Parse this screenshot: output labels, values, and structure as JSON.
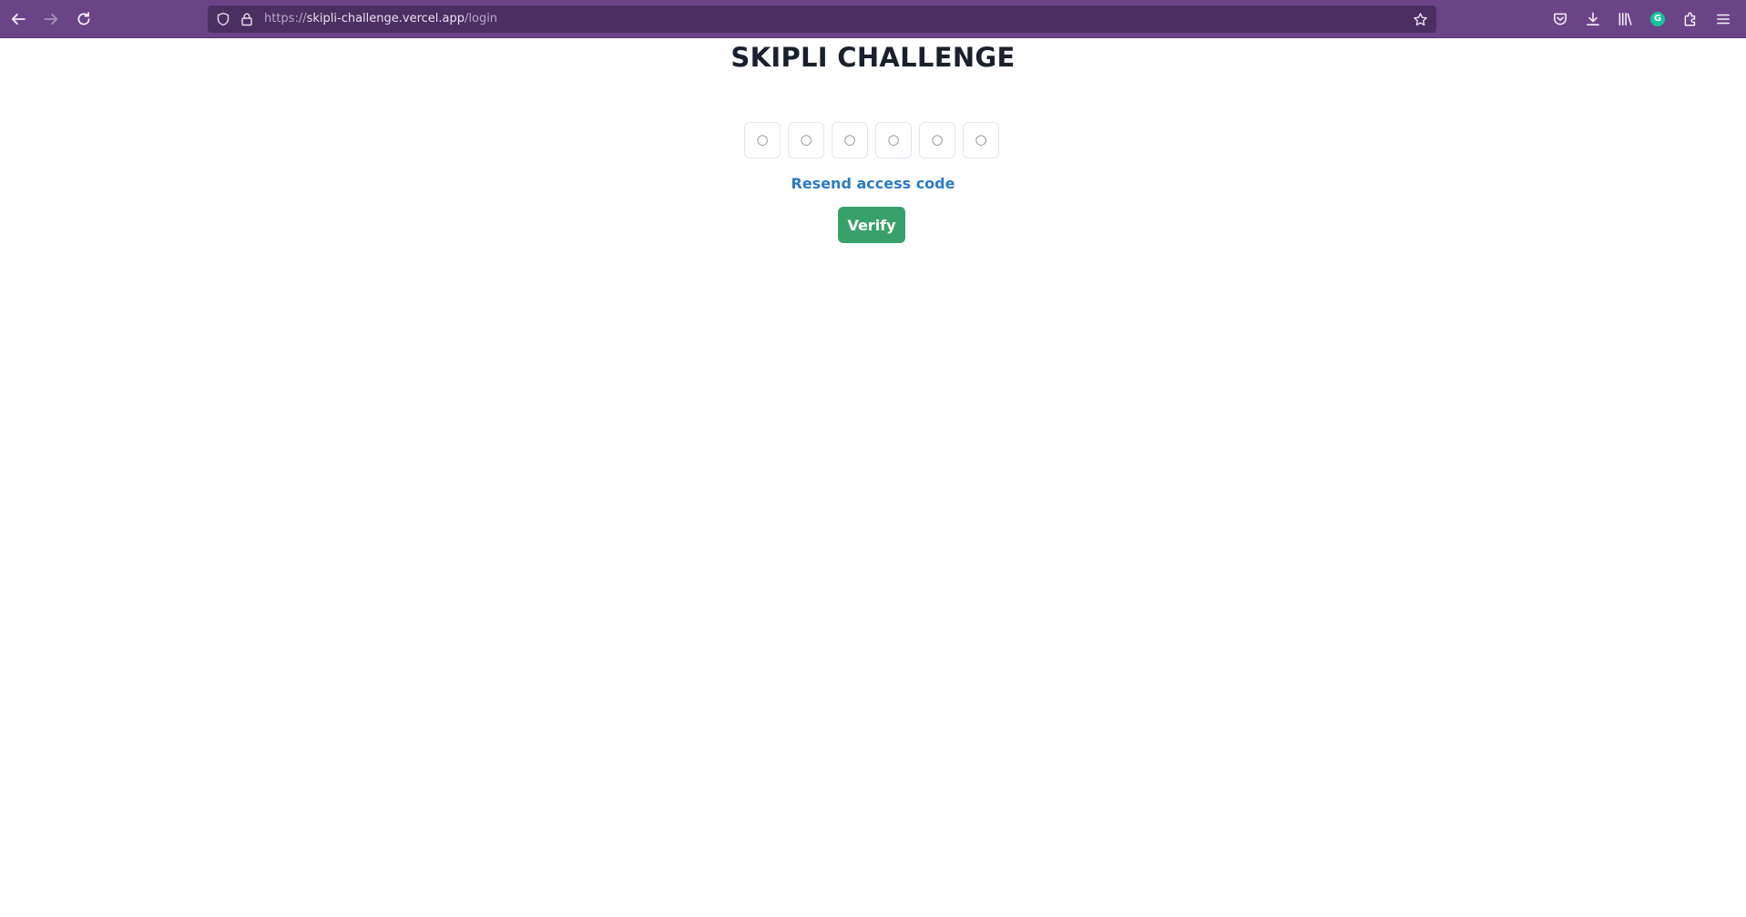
{
  "browser": {
    "url_prefix": "https://",
    "url_host": "skipli-challenge.vercel.app",
    "url_path": "/login",
    "grammarly_letter": "G"
  },
  "page": {
    "title": "SKIPLI CHALLENGE",
    "pin_placeholder": "○",
    "pin_count": 6,
    "resend_label": "Resend access code",
    "verify_label": "Verify"
  },
  "colors": {
    "toolbar": "#6b4488",
    "urlbar": "#4b2f63",
    "link": "#2b7bc4",
    "verify_button": "#38a169",
    "title": "#1a202c"
  }
}
